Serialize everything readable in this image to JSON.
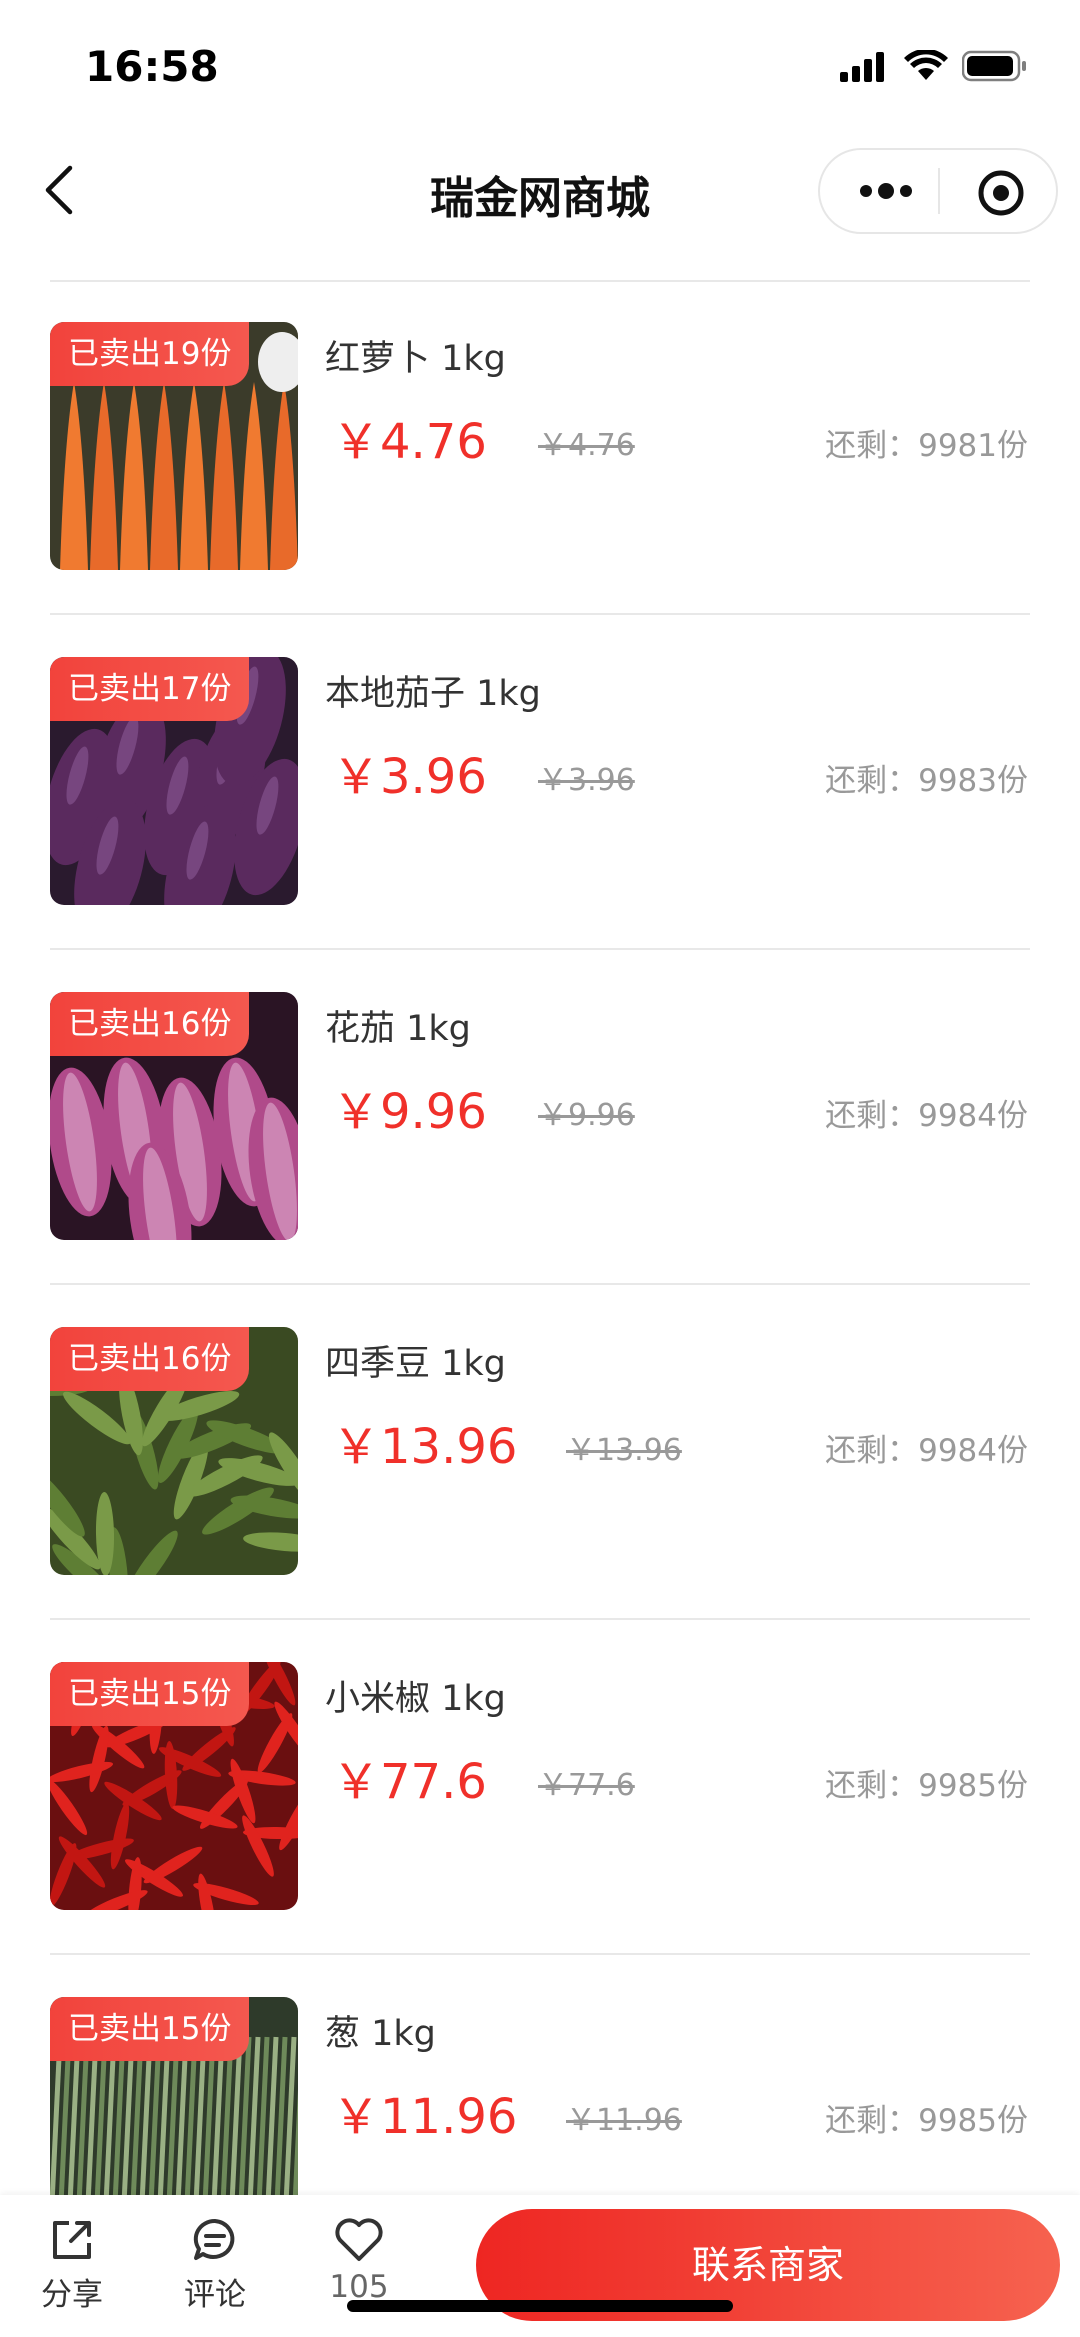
{
  "status": {
    "time": "16:58"
  },
  "navbar": {
    "title": "瑞金网商城"
  },
  "products": [
    {
      "sold": "已卖出19份",
      "name": "红萝卜 1kg",
      "price": "￥4.76",
      "orig": "￥4.76",
      "stock": "还剩：9981份",
      "image": "carrot"
    },
    {
      "sold": "已卖出17份",
      "name": "本地茄子 1kg",
      "price": "￥3.96",
      "orig": "￥3.96",
      "stock": "还剩：9983份",
      "image": "eggplant"
    },
    {
      "sold": "已卖出16份",
      "name": "花茄 1kg",
      "price": "￥9.96",
      "orig": "￥9.96",
      "stock": "还剩：9984份",
      "image": "striped-eggplant"
    },
    {
      "sold": "已卖出16份",
      "name": "四季豆 1kg",
      "price": "￥13.96",
      "orig": "￥13.96",
      "stock": "还剩：9984份",
      "image": "green-beans"
    },
    {
      "sold": "已卖出15份",
      "name": "小米椒 1kg",
      "price": "￥77.6",
      "orig": "￥77.6",
      "stock": "还剩：9985份",
      "image": "chili"
    },
    {
      "sold": "已卖出15份",
      "name": "葱 1kg",
      "price": "￥11.96",
      "orig": "￥11.96",
      "stock": "还剩：9985份",
      "image": "scallion"
    }
  ],
  "bottom": {
    "share": "分享",
    "comment": "评论",
    "likes": "105",
    "contact": "联系商家"
  },
  "colors": {
    "price": "#f0302a",
    "accent": "#f2433c",
    "muted": "#999999"
  }
}
